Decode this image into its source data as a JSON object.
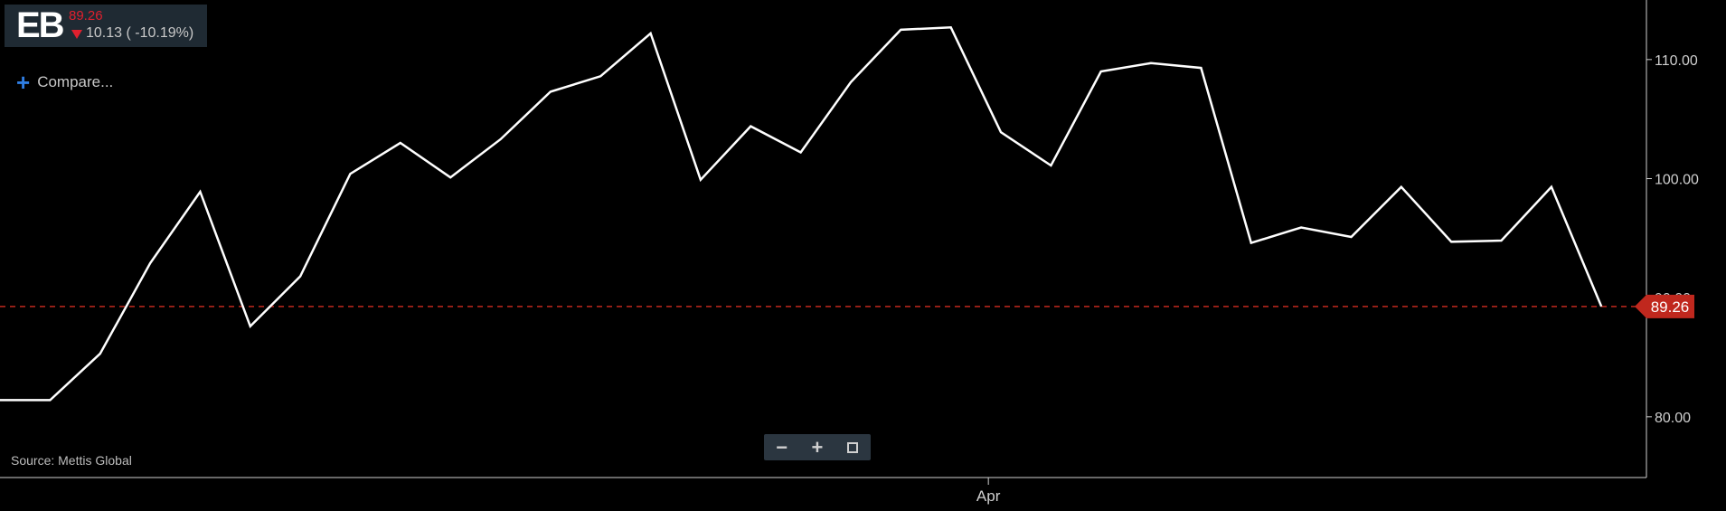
{
  "ticker": {
    "symbol": "EB",
    "price": "89.26",
    "change": "10.13 ( -10.19%)",
    "direction": "down"
  },
  "compare_label": "Compare...",
  "source": "Source: Mettis Global",
  "zoom_controls": {
    "zoom_out": "−",
    "zoom_in": "+",
    "fullscreen_icon": "fullscreen-icon"
  },
  "colors": {
    "line": "#ffffff",
    "price_line": "#c0281e",
    "price_badge": "#c0281e",
    "background": "#000000",
    "down": "#e0202e"
  },
  "chart_data": {
    "type": "line",
    "series": [
      {
        "values": [
          81.4,
          81.4,
          85.3,
          92.9,
          98.9,
          87.6,
          91.8,
          100.4,
          103.0,
          100.1,
          103.3,
          107.3,
          108.6,
          112.2,
          99.9,
          104.4,
          102.2,
          108.1,
          112.5,
          112.7,
          103.9,
          101.1,
          109.0,
          109.7,
          109.3,
          94.6,
          95.9,
          95.1,
          99.3,
          94.7,
          94.8,
          99.3,
          89.26
        ]
      }
    ],
    "x_tick_labels": [
      {
        "label": "Apr",
        "index": 19.75
      }
    ],
    "y_ticks": [
      80,
      90,
      100,
      110
    ],
    "y_tick_labels": [
      "80.00",
      "90.00",
      "100.00",
      "110.00"
    ],
    "ylim": [
      74.9,
      115
    ],
    "last_price_label": "89.26",
    "last_price": 89.26
  }
}
